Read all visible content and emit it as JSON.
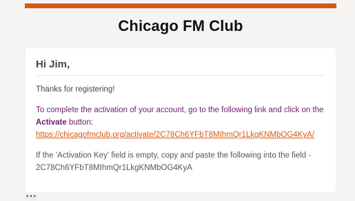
{
  "header": {
    "title": "Chicago FM Club",
    "accent_color": "#d45a16"
  },
  "email": {
    "greeting": "Hi Jim,",
    "thanks": "Thanks for registering!",
    "instruction_prefix": "To complete the activation of your account, go to the following link and click on the ",
    "instruction_button_word": "Activate",
    "instruction_suffix": " button:",
    "activation_link": "https://chicagofmclub.org/activate/2C78Ch6YFbT8MIhmQr1LkgKNMbOG4KyA/",
    "empty_key_note": "If the 'Activation Key' field is empty, copy and paste the following into the field -",
    "activation_key": "2C78Ch6YFbT8MIhmQr1LkgKNMbOG4KyA"
  },
  "footer": {
    "more_label": "•••",
    "more_icon": "ellipsis-icon"
  }
}
